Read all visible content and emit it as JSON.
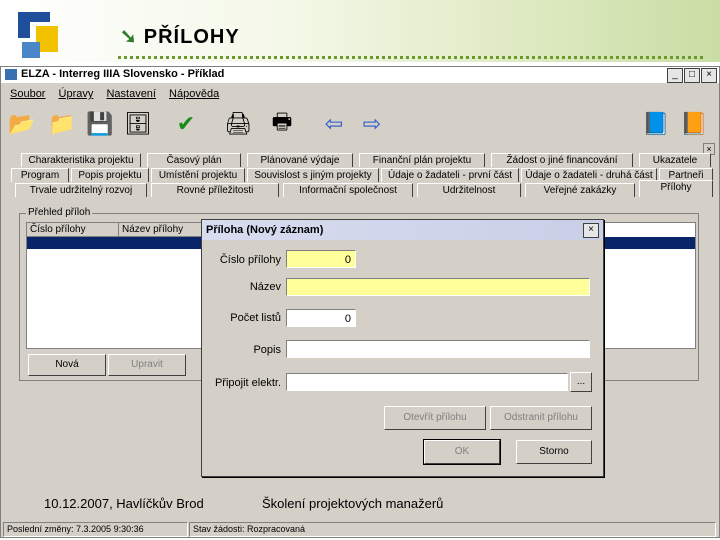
{
  "slide": {
    "title": "PŘÍLOHY",
    "footer_date": "10.12.2007, Havlíčkův Brod",
    "footer_event": "Školení projektových manažerů"
  },
  "window": {
    "title": "ELZA - Interreg IIIA Slovensko - Příklad",
    "min_label": "_",
    "max_label": "□",
    "close_label": "×"
  },
  "menu": [
    "Soubor",
    "Úpravy",
    "Nastavení",
    "Nápověda"
  ],
  "toolbar": {
    "icons": [
      "open-folder-icon",
      "folder-icon",
      "floppy-disk-icon",
      "network-save-icon",
      "check-icon",
      "printer-gray-icon",
      "printer-icon",
      "arrow-left-icon",
      "arrow-right-icon",
      "book-icon",
      "help-book-icon"
    ]
  },
  "tabs": {
    "row1": [
      "Charakteristika projektu",
      "Časový plán",
      "Plánované výdaje",
      "Finanční plán projektu",
      "Žádost o jiné financování",
      "Ukazatele"
    ],
    "row2": [
      "Program",
      "Popis projektu",
      "Umístění projektu",
      "Souvislost s jiným projekty",
      "Údaje o žadateli - první část",
      "Údaje o žadateli - druhá část",
      "Partneři"
    ],
    "row3": [
      "Trvale udržitelný rozvoj",
      "Rovné příležitosti",
      "Informační společnost",
      "Udržitelnost",
      "Veřejné zakázky",
      "Přílohy"
    ]
  },
  "overview": {
    "group_label": "Přehled příloh",
    "columns": [
      "Číslo přílohy",
      "Název přílohy"
    ],
    "new_button": "Nová",
    "edit_button": "Upravit"
  },
  "status": {
    "last_change": "Poslední změny: 7.3.2005 9:30:36",
    "request_state": "Stav žádosti: Rozpracovaná"
  },
  "dialog": {
    "title": "Příloha (Nový záznam)",
    "close_label": "×",
    "fields": {
      "number_label": "Číslo přílohy",
      "number_value": "0",
      "name_label": "Název",
      "name_value": "",
      "pages_label": "Počet listů",
      "pages_value": "0",
      "description_label": "Popis",
      "description_value": "",
      "attach_label": "Připojit elektr.",
      "attach_value": "",
      "browse_label": "..."
    },
    "buttons": {
      "open": "Otevřít přílohu",
      "remove": "Odstranit přílohu",
      "ok": "OK",
      "cancel": "Storno"
    }
  },
  "colors": {
    "selection": "#0a246a",
    "required_field": "#ffff99",
    "window_face": "#d4d0c8"
  }
}
